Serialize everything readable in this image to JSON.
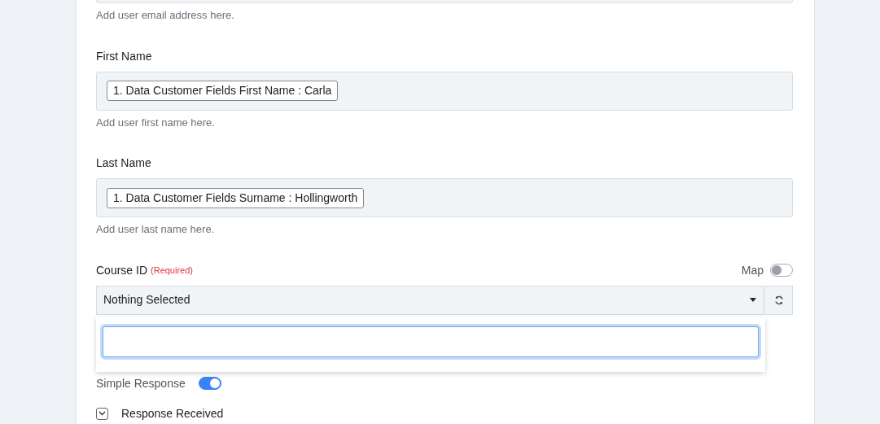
{
  "email": {
    "help": "Add user email address here."
  },
  "first_name": {
    "label": "First Name",
    "value": "1. Data Customer Fields First Name : Carla",
    "help": "Add user first name here."
  },
  "last_name": {
    "label": "Last Name",
    "value": "1. Data Customer Fields Surname : Hollingworth",
    "help": "Add user last name here."
  },
  "course_id": {
    "label": "Course ID",
    "required": "(Required)",
    "map_label": "Map",
    "map_on": false,
    "select": "Nothing Selected",
    "dropdown_open": true
  },
  "simple_response": {
    "label": "Simple Response",
    "on": true
  },
  "response_received": {
    "label": "Response Received"
  }
}
